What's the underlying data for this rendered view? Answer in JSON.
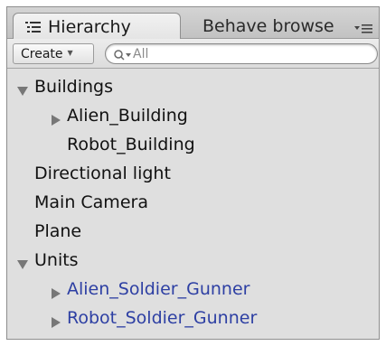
{
  "tabs": {
    "hierarchy": "Hierarchy",
    "behave": "Behave browse"
  },
  "toolbar": {
    "create_label": "Create",
    "search_placeholder": "All"
  },
  "tree": {
    "buildings": "Buildings",
    "alien_building": "Alien_Building",
    "robot_building": "Robot_Building",
    "directional_light": "Directional light",
    "main_camera": "Main Camera",
    "plane": "Plane",
    "units": "Units",
    "alien_soldier": "Alien_Soldier_Gunner",
    "robot_soldier": "Robot_Soldier_Gunner"
  },
  "colors": {
    "prefab_text": "#2d3fa3",
    "panel_bg": "#dfdfdf"
  }
}
